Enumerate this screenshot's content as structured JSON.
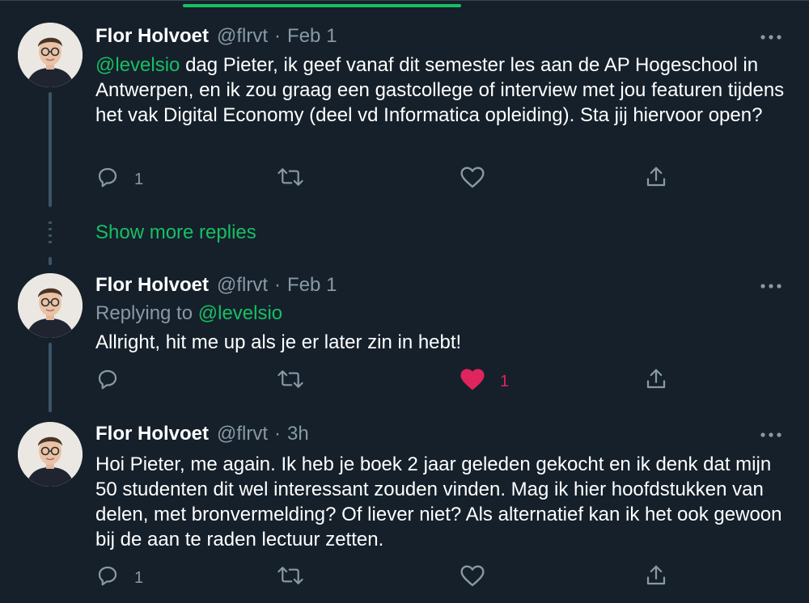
{
  "tweets": [
    {
      "name": "Flor Holvoet",
      "handle": "@flrvt",
      "dot": "·",
      "time": "Feb 1",
      "mention": "@levelsio",
      "text_after_mention": " dag Pieter, ik geef vanaf dit semester les aan de AP Hogeschool in Antwerpen, en ik zou graag een gastcollege of interview met jou featuren tijdens het vak Digital Economy (deel vd Informatica opleiding). Sta jij hiervoor open?",
      "reply_count": "1",
      "retweet_count": "",
      "like_count": ""
    },
    {
      "name": "Flor Holvoet",
      "handle": "@flrvt",
      "dot": "·",
      "time": "Feb 1",
      "replying_label": "Replying to",
      "replying_to": "@levelsio",
      "text": "Allright, hit me up als je er later zin in hebt!",
      "reply_count": "",
      "retweet_count": "",
      "like_count": "1"
    },
    {
      "name": "Flor Holvoet",
      "handle": "@flrvt",
      "dot": "·",
      "time": "3h",
      "text": "Hoi Pieter, me again. Ik heb je boek 2 jaar geleden gekocht en ik denk dat mijn 50 studenten dit wel interessant zouden vinden. Mag ik hier hoofdstukken van delen, met bronvermelding? Of liever niet? Als alternatief kan ik het ook gewoon bij de aan te raden lectuur zetten.",
      "reply_count": "1",
      "retweet_count": "",
      "like_count": ""
    }
  ],
  "show_more_replies": "Show more replies",
  "icons": {
    "reply": "reply-icon",
    "retweet": "retweet-icon",
    "like": "heart-icon",
    "share": "share-icon",
    "more": "more-icon"
  },
  "colors": {
    "background": "#15202b",
    "accent": "#17bf63",
    "muted": "#8899a6",
    "like": "#e0245e"
  }
}
